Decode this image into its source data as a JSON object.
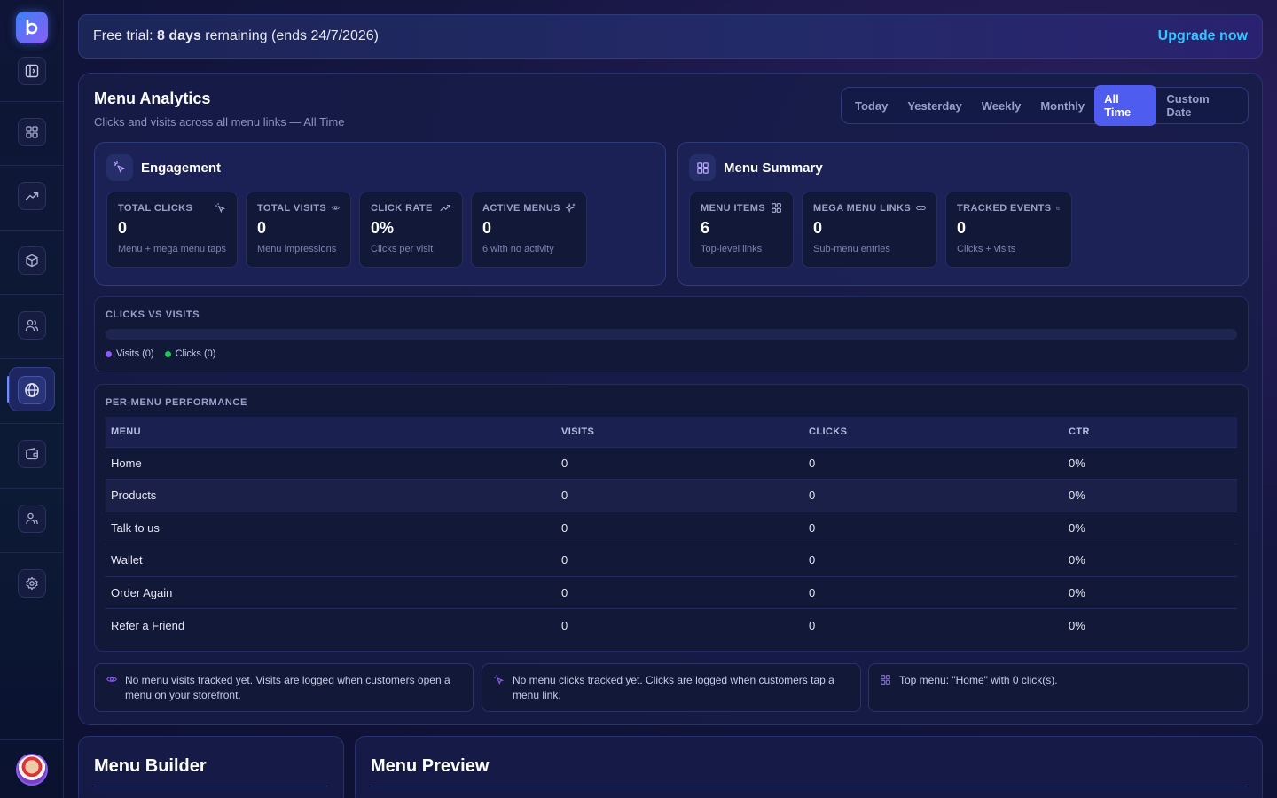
{
  "trial": {
    "prefix": "Free trial:",
    "days": "8 days",
    "suffix": "remaining (ends 24/7/2026)",
    "upgrade_label": "Upgrade now"
  },
  "analytics": {
    "title": "Menu Analytics",
    "subtitle": "Clicks and visits across all menu links — All Time",
    "tabs": [
      "Today",
      "Yesterday",
      "Weekly",
      "Monthly",
      "All Time",
      "Custom Date"
    ],
    "active_tab": "All Time"
  },
  "engagement": {
    "title": "Engagement",
    "metrics": [
      {
        "label": "TOTAL CLICKS",
        "value": "0",
        "sub": "Menu + mega menu taps",
        "icon": "sparkle-click-icon"
      },
      {
        "label": "TOTAL VISITS",
        "value": "0",
        "sub": "Menu impressions",
        "icon": "eye-icon"
      },
      {
        "label": "CLICK RATE",
        "value": "0%",
        "sub": "Clicks per visit",
        "icon": "trending-up-icon"
      },
      {
        "label": "ACTIVE MENUS",
        "value": "0",
        "sub": "6 with no activity",
        "icon": "sparkles-icon"
      }
    ]
  },
  "summary": {
    "title": "Menu Summary",
    "metrics": [
      {
        "label": "MENU ITEMS",
        "value": "6",
        "sub": "Top-level links",
        "icon": "grid-icon"
      },
      {
        "label": "MEGA MENU LINKS",
        "value": "0",
        "sub": "Sub-menu entries",
        "icon": "link-icon"
      },
      {
        "label": "TRACKED EVENTS",
        "value": "0",
        "sub": "Clicks + visits",
        "icon": "bar-chart-icon"
      }
    ]
  },
  "clicks_vs_visits": {
    "label": "CLICKS VS VISITS",
    "legend": [
      {
        "label": "Visits (0)",
        "color": "#8b5cf6"
      },
      {
        "label": "Clicks (0)",
        "color": "#22c55e"
      }
    ]
  },
  "per_menu": {
    "label": "PER-MENU PERFORMANCE",
    "columns": [
      "MENU",
      "VISITS",
      "CLICKS",
      "CTR"
    ],
    "rows": [
      [
        "Home",
        "0",
        "0",
        "0%"
      ],
      [
        "Products",
        "0",
        "0",
        "0%"
      ],
      [
        "Talk to us",
        "0",
        "0",
        "0%"
      ],
      [
        "Wallet",
        "0",
        "0",
        "0%"
      ],
      [
        "Order Again",
        "0",
        "0",
        "0%"
      ],
      [
        "Refer a Friend",
        "0",
        "0",
        "0%"
      ]
    ]
  },
  "notes": [
    {
      "text": "No menu visits tracked yet. Visits are logged when customers open a menu on your storefront.",
      "icon": "eye-icon"
    },
    {
      "text": "No menu clicks tracked yet. Clicks are logged when customers tap a menu link.",
      "icon": "sparkle-click-icon"
    },
    {
      "text": "Top menu: \"Home\" with 0 click(s).",
      "icon": "grid-icon"
    }
  ],
  "bottom": {
    "builder_title": "Menu Builder",
    "preview_title": "Menu Preview"
  },
  "colors": {
    "accent": "#4f5cf0",
    "upgrade": "#34c6ff",
    "visits": "#8b5cf6",
    "clicks": "#22c55e"
  }
}
